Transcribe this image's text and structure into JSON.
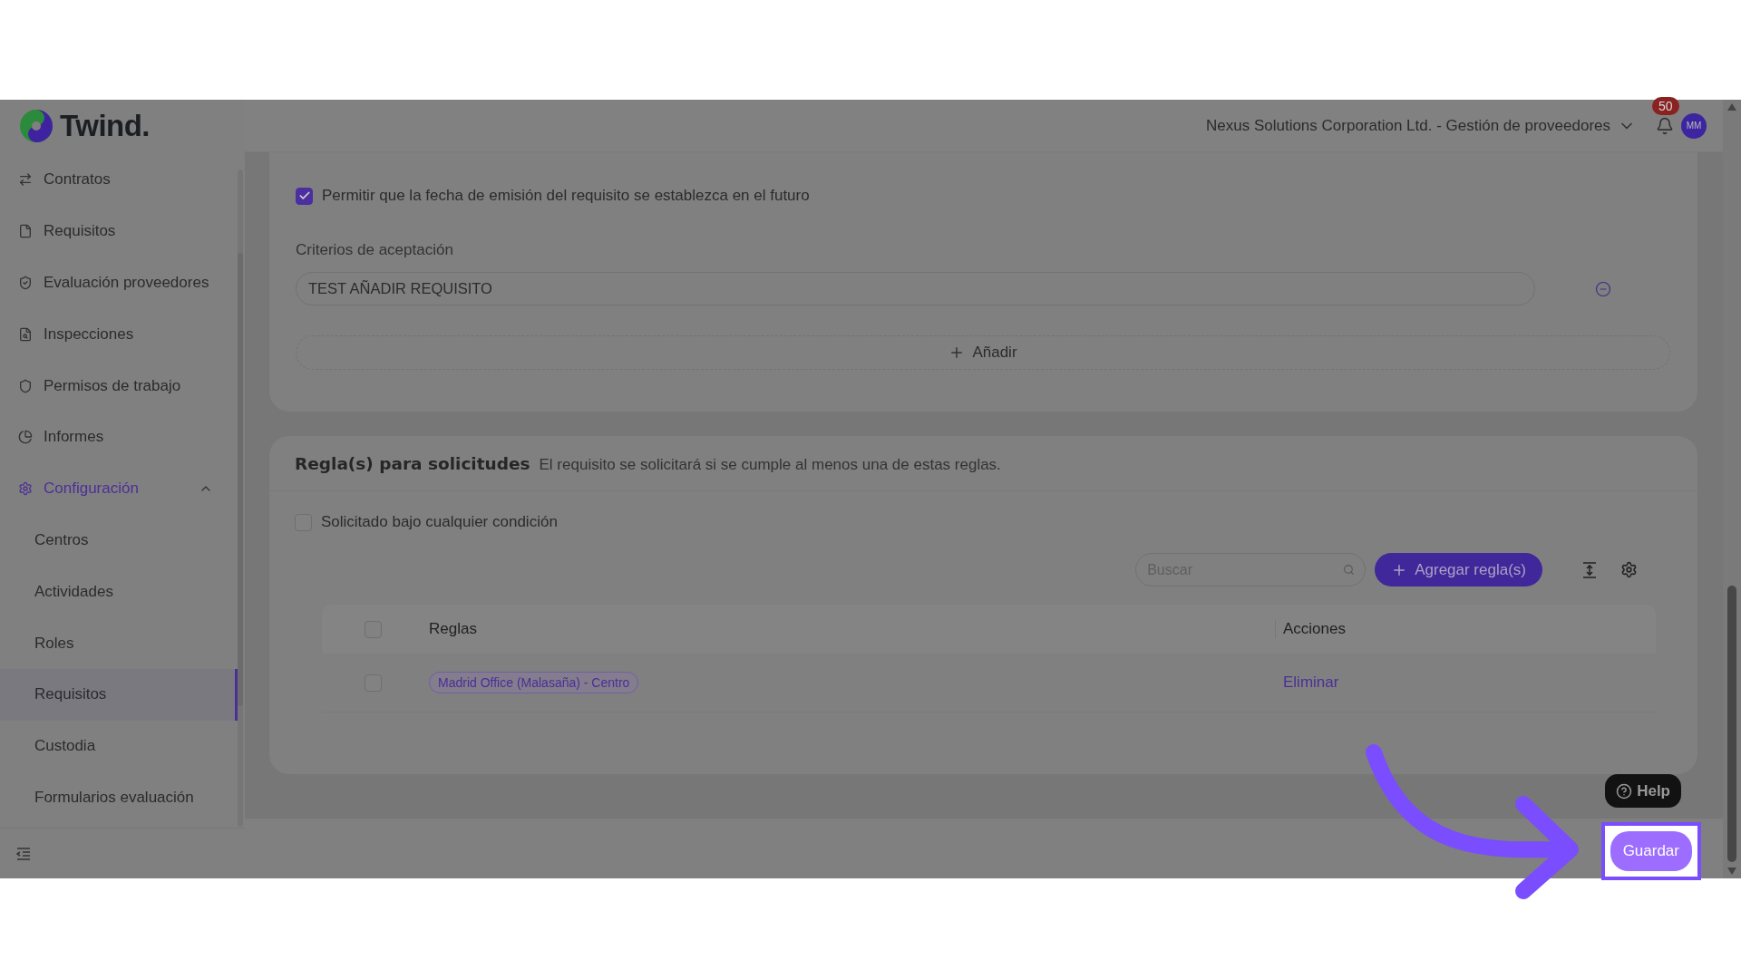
{
  "logo": {
    "text": "Twind."
  },
  "sidebar": {
    "items": [
      {
        "label": "Contratos",
        "selected": false
      },
      {
        "label": "Requisitos",
        "selected": false
      },
      {
        "label": "Evaluación proveedores",
        "selected": false
      },
      {
        "label": "Inspecciones",
        "selected": false
      },
      {
        "label": "Permisos de trabajo",
        "selected": false
      },
      {
        "label": "Informes",
        "selected": false
      },
      {
        "label": "Configuración",
        "selected": true,
        "expanded": true,
        "children": [
          {
            "label": "Centros",
            "selected": false
          },
          {
            "label": "Actividades",
            "selected": false
          },
          {
            "label": "Roles",
            "selected": false
          },
          {
            "label": "Requisitos",
            "selected": true
          },
          {
            "label": "Custodia",
            "selected": false
          },
          {
            "label": "Formularios evaluación",
            "selected": false
          }
        ]
      }
    ]
  },
  "topbar": {
    "company": "Nexus Solutions Corporation Ltd. - Gestión de proveedores",
    "notifications": "50",
    "avatar": "MM"
  },
  "requirement_card": {
    "future_date": {
      "label": "Permitir que la fecha de emisión del requisito se establezca en el futuro",
      "checked": true
    },
    "criteria_label": "Criterios de aceptación",
    "criteria": [
      {
        "value": "TEST AÑADIR REQUISITO"
      }
    ],
    "add_button": "Añadir"
  },
  "rules_card": {
    "title": "Regla(s) para solicitudes",
    "description": "El requisito se solicitará si se cumple al menos una de estas reglas.",
    "any_condition": {
      "label": "Solicitado bajo cualquier condición",
      "checked": false
    },
    "search": {
      "placeholder": "Buscar"
    },
    "add_rule_button": "Agregar regla(s)",
    "table": {
      "header_checked": false,
      "columns": [
        "Reglas",
        "Acciones"
      ],
      "rows": [
        {
          "rule": "Madrid Office (Malasaña) - Centro",
          "action": "Eliminar",
          "selected": false
        }
      ]
    }
  },
  "help_button": "Help",
  "save_button": {
    "label": "Guardar",
    "highlighted": true
  }
}
